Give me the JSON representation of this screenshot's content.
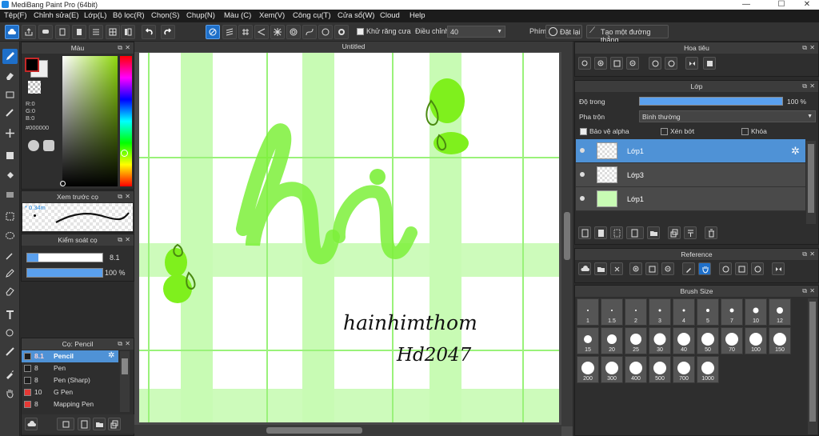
{
  "window": {
    "title": "MediBang Paint Pro (64bit)",
    "minimize": "—",
    "maximize": "☐",
    "close": "✕"
  },
  "menu": [
    "Tệp(F)",
    "Chỉnh sửa(E)",
    "Lớp(L)",
    "Bộ lọc(R)",
    "Chọn(S)",
    "Chụp(N)",
    "Màu (C)",
    "Xem(V)",
    "Công cụ(T)",
    "Cửa sổ(W)",
    "Cloud",
    "Help"
  ],
  "toolbar": {
    "antialias_label": "Khử răng cưa",
    "adjust_label": "Điều chỉnh",
    "adjust_value": "40",
    "key_label": "Phím",
    "reset_label": "Đặt lại",
    "straight_line_label": "Tạo một đường thẳng"
  },
  "color_panel": {
    "title": "Màu",
    "r": "R:0",
    "g": "G:0",
    "b": "B:0",
    "hex": "#000000",
    "fg": "#000000",
    "bg": "#ffffff"
  },
  "brush_preview": {
    "title": "Xem trước cọ",
    "size": "0.34m"
  },
  "brush_control": {
    "title": "Kiểm soát cọ",
    "size_value": "8.1",
    "opacity_value": "100 %"
  },
  "brush_list": {
    "title": "Cọ: Pencil",
    "items": [
      {
        "size": "8.1",
        "name": "Pencil",
        "color": "#1e1e1e"
      },
      {
        "size": "8",
        "name": "Pen",
        "color": "#1e1e1e"
      },
      {
        "size": "8",
        "name": "Pen (Sharp)",
        "color": "#1e1e1e"
      },
      {
        "size": "10",
        "name": "G Pen",
        "color": "#e53935"
      },
      {
        "size": "8",
        "name": "Mapping Pen",
        "color": "#e53935"
      }
    ]
  },
  "canvas": {
    "tab": "Untitled",
    "word": "hi",
    "signature_line1": "hainhimthom",
    "signature_line2": "Hd2047",
    "accent": "#7cf03a"
  },
  "navigator": {
    "title": "Hoa tiêu"
  },
  "layer_panel": {
    "title": "Lớp",
    "opacity_label": "Độ trong",
    "opacity_value": "100 %",
    "opacity_fraction": 1.0,
    "blend_label": "Pha trộn",
    "blend_value": "Bình thường",
    "protect_alpha": "Bảo vệ alpha",
    "clipping": "Xén bớt",
    "lock": "Khóa",
    "layers": [
      {
        "name": "Lớp1",
        "selected": true
      },
      {
        "name": "Lớp3",
        "selected": false
      },
      {
        "name": "Lớp1",
        "selected": false
      }
    ]
  },
  "reference": {
    "title": "Reference"
  },
  "brush_size": {
    "title": "Brush Size",
    "sizes": [
      "1",
      "1.5",
      "2",
      "3",
      "4",
      "5",
      "7",
      "10",
      "12",
      "15",
      "20",
      "25",
      "30",
      "40",
      "50",
      "70",
      "100",
      "150",
      "200",
      "300",
      "400",
      "500",
      "700",
      "1000"
    ]
  }
}
